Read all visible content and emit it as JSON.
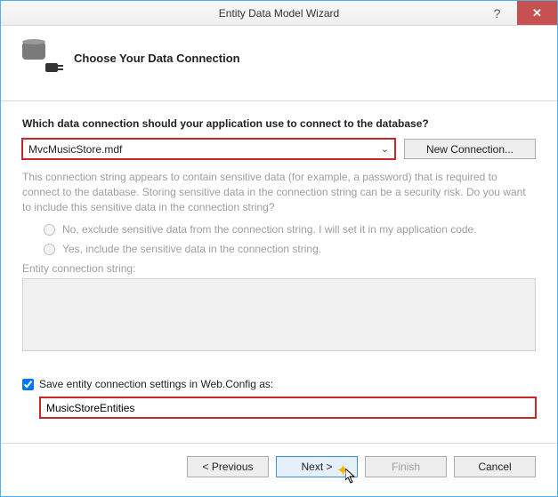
{
  "window": {
    "title": "Entity Data Model Wizard",
    "help": "?",
    "close": "✕"
  },
  "header": {
    "subtitle": "Choose Your Data Connection"
  },
  "main": {
    "question": "Which data connection should your application use to connect to the database?",
    "selected_connection": "MvcMusicStore.mdf",
    "new_connection_label": "New Connection...",
    "info_text": "This connection string appears to contain sensitive data (for example, a password) that is required to connect to the database. Storing sensitive data in the connection string can be a security risk. Do you want to include this sensitive data in the connection string?",
    "radio_no": "No, exclude sensitive data from the connection string. I will set it in my application code.",
    "radio_yes": "Yes, include the sensitive data in the connection string.",
    "ecs_label": "Entity connection string:",
    "ecs_value": "",
    "save_checkbox_label": "Save entity connection settings in Web.Config as:",
    "save_checked": true,
    "config_name": "MusicStoreEntities"
  },
  "footer": {
    "previous": "< Previous",
    "next": "Next >",
    "finish": "Finish",
    "cancel": "Cancel"
  }
}
